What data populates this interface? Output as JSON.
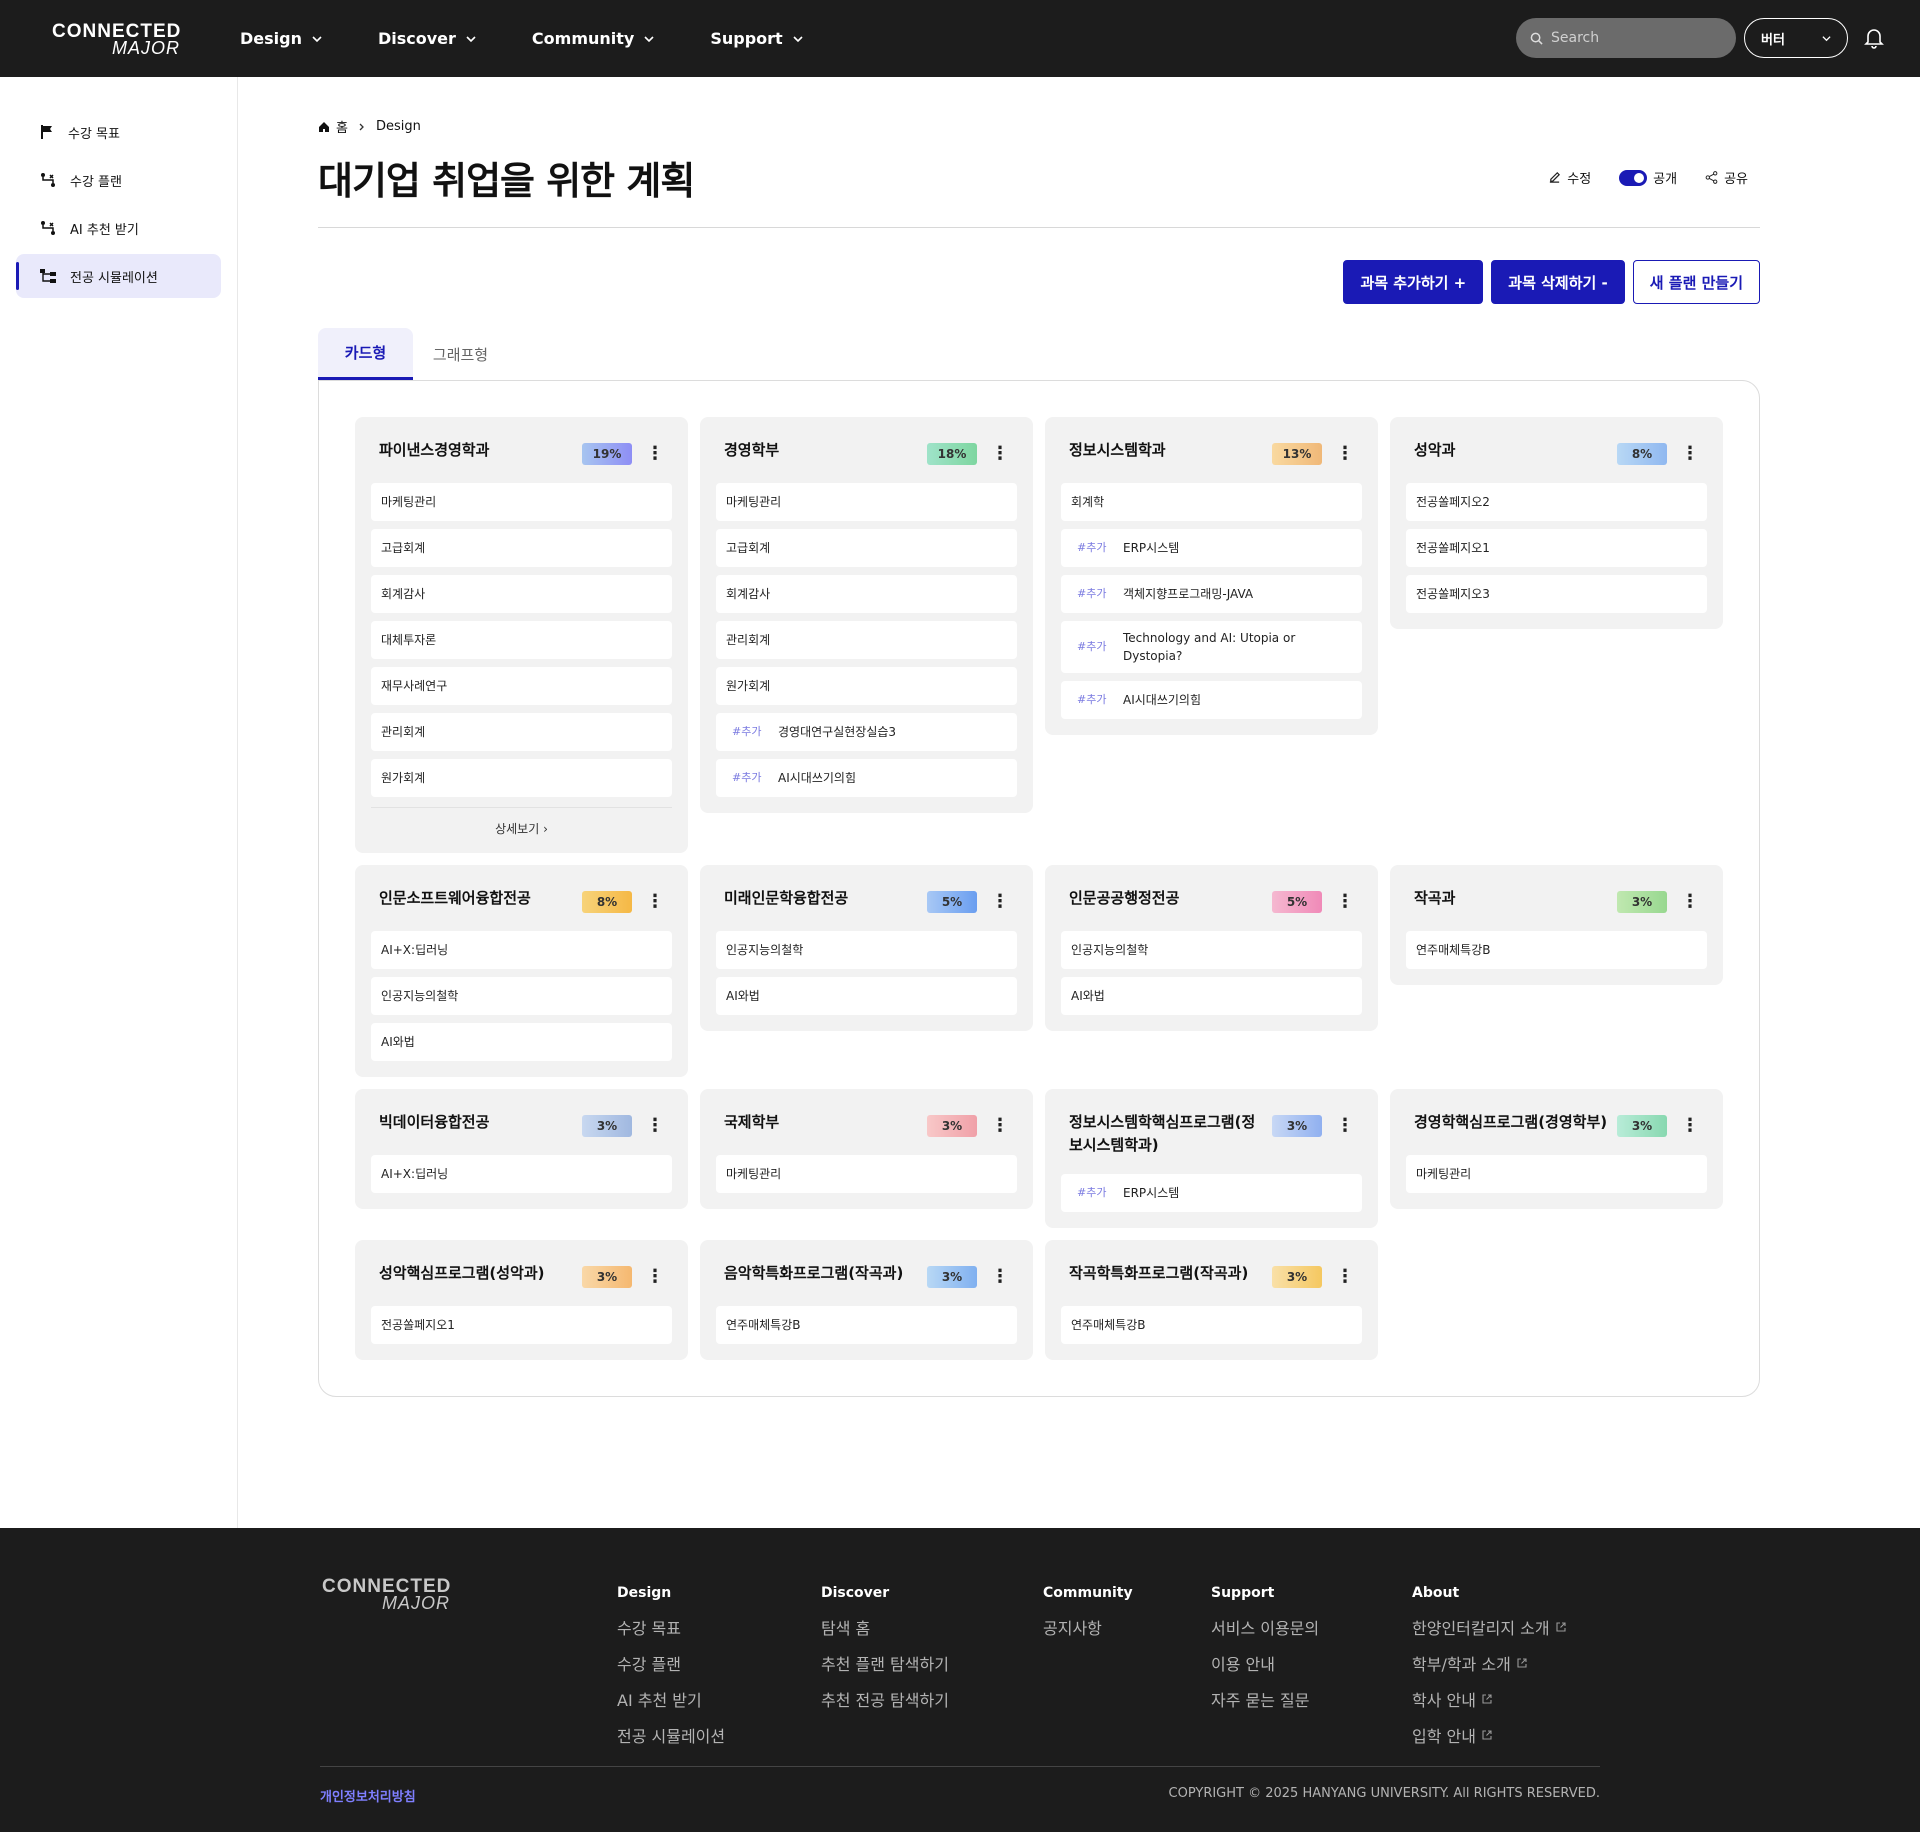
{
  "header": {
    "logo_line1": "CONNECTED",
    "logo_line2": "MAJOR",
    "nav": [
      "Design",
      "Discover",
      "Community",
      "Support"
    ],
    "search_placeholder": "Search",
    "version_label": "버터"
  },
  "sidebar": {
    "items": [
      {
        "label": "수강 목표",
        "icon": "flag-icon"
      },
      {
        "label": "수강 플랜",
        "icon": "route-icon"
      },
      {
        "label": "AI 추천 받기",
        "icon": "route-icon"
      },
      {
        "label": "전공 시뮬레이션",
        "icon": "tree-icon",
        "active": true
      }
    ]
  },
  "breadcrumb": {
    "home": "홈",
    "current": "Design"
  },
  "page": {
    "title": "대기업 취업을 위한 계획",
    "edit_label": "수정",
    "public_label": "공개",
    "share_label": "공유"
  },
  "buttons": {
    "add": "과목 추가하기 +",
    "remove": "과목 삭제하기 -",
    "new_plan": "새 플랜 만들기"
  },
  "tabs": [
    "카드형",
    "그래프형"
  ],
  "colors": {
    "accent": "#1a1ab5"
  },
  "cards": [
    {
      "title": "파이낸스경영학과",
      "pct": "19%",
      "grad": "linear-gradient(90deg,#a7c5f0,#8e8ef5)",
      "courses": [
        {
          "name": "마케팅관리"
        },
        {
          "name": "고급회계"
        },
        {
          "name": "회계감사"
        },
        {
          "name": "대체투자론"
        },
        {
          "name": "재무사례연구"
        },
        {
          "name": "관리회계"
        },
        {
          "name": "원가회계"
        }
      ],
      "more": "상세보기"
    },
    {
      "title": "경영학부",
      "pct": "18%",
      "grad": "linear-gradient(90deg,#9fe3c9,#7ed6a0)",
      "courses": [
        {
          "name": "마케팅관리"
        },
        {
          "name": "고급회계"
        },
        {
          "name": "회계감사"
        },
        {
          "name": "관리회계"
        },
        {
          "name": "원가회계"
        },
        {
          "name": "경영대연구실현장실습3",
          "tag": "#추가"
        },
        {
          "name": "AI시대쓰기의힘",
          "tag": "#추가"
        }
      ]
    },
    {
      "title": "정보시스템학과",
      "pct": "13%",
      "grad": "linear-gradient(90deg,#f9d9a0,#f0b878)",
      "courses": [
        {
          "name": "회계학"
        },
        {
          "name": "ERP시스템",
          "tag": "#추가"
        },
        {
          "name": "객체지향프로그래밍-JAVA",
          "tag": "#추가"
        },
        {
          "name": "Technology and AI: Utopia or Dystopia?",
          "tag": "#추가"
        },
        {
          "name": "AI시대쓰기의힘",
          "tag": "#추가"
        }
      ]
    },
    {
      "title": "성악과",
      "pct": "8%",
      "grad": "linear-gradient(90deg,#b8d8f5,#90b8f0)",
      "courses": [
        {
          "name": "전공쏠페지오2"
        },
        {
          "name": "전공쏠페지오1"
        },
        {
          "name": "전공쏠페지오3"
        }
      ]
    },
    {
      "title": "인문소프트웨어융합전공",
      "pct": "8%",
      "grad": "linear-gradient(90deg,#f7d37a,#f5b845)",
      "courses": [
        {
          "name": "AI+X:딥러닝"
        },
        {
          "name": "인공지능의철학"
        },
        {
          "name": "AI와법"
        }
      ]
    },
    {
      "title": "미래인문학융합전공",
      "pct": "5%",
      "grad": "linear-gradient(90deg,#a8c8f5,#6a9ef0)",
      "courses": [
        {
          "name": "인공지능의철학"
        },
        {
          "name": "AI와법"
        }
      ]
    },
    {
      "title": "인문공공행정전공",
      "pct": "5%",
      "grad": "linear-gradient(90deg,#f5b8d0,#f08ab8)",
      "courses": [
        {
          "name": "인공지능의철학"
        },
        {
          "name": "AI와법"
        }
      ]
    },
    {
      "title": "작곡과",
      "pct": "3%",
      "grad": "linear-gradient(90deg,#c0e8b0,#98d890)",
      "courses": [
        {
          "name": "연주매체특강B"
        }
      ]
    },
    {
      "title": "빅데이터융합전공",
      "pct": "3%",
      "grad": "linear-gradient(90deg,#c8d8f0,#a0b8e0)",
      "courses": [
        {
          "name": "AI+X:딥러닝"
        }
      ]
    },
    {
      "title": "국제학부",
      "pct": "3%",
      "grad": "linear-gradient(90deg,#f8c8c8,#f0a0a8)",
      "courses": [
        {
          "name": "마케팅관리"
        }
      ]
    },
    {
      "title": "정보시스템학핵심프로그램(정보시스템학과)",
      "pct": "3%",
      "grad": "linear-gradient(90deg,#c8d8f5,#90b0f0)",
      "courses": [
        {
          "name": "ERP시스템",
          "tag": "#추가"
        }
      ]
    },
    {
      "title": "경영학핵심프로그램(경영학부)",
      "pct": "3%",
      "grad": "linear-gradient(90deg,#b8ecd8,#88d8b0)",
      "courses": [
        {
          "name": "마케팅관리"
        }
      ]
    },
    {
      "title": "성악핵심프로그램(성악과)",
      "pct": "3%",
      "grad": "linear-gradient(90deg,#f9d8a8,#f5b870)",
      "courses": [
        {
          "name": "전공쏠페지오1"
        }
      ]
    },
    {
      "title": "음악학특화프로그램(작곡과)",
      "pct": "3%",
      "grad": "linear-gradient(90deg,#b8d8f5,#80b0f0)",
      "courses": [
        {
          "name": "연주매체특강B"
        }
      ]
    },
    {
      "title": "작곡학특화프로그램(작곡과)",
      "pct": "3%",
      "grad": "linear-gradient(90deg,#f9e0a8,#f5c860)",
      "courses": [
        {
          "name": "연주매체특강B"
        }
      ]
    }
  ],
  "footer": {
    "columns": [
      {
        "title": "Design",
        "links": [
          "수강 목표",
          "수강 플랜",
          "AI 추천 받기",
          "전공 시뮬레이션"
        ]
      },
      {
        "title": "Discover",
        "links": [
          "탐색 홈",
          "추천 플랜 탐색하기",
          "추천 전공 탐색하기"
        ]
      },
      {
        "title": "Community",
        "links": [
          "공지사항"
        ]
      },
      {
        "title": "Support",
        "links": [
          "서비스 이용문의",
          "이용 안내",
          "자주 묻는 질문"
        ]
      },
      {
        "title": "About",
        "links": [
          "한양인터칼리지 소개",
          "학부/학과 소개",
          "학사 안내",
          "입학 안내"
        ],
        "external": true
      }
    ],
    "privacy": "개인정보처리방침",
    "copyright": "COPYRIGHT © 2025 HANYANG UNIVERSITY. All RIGHTS RESERVED."
  }
}
